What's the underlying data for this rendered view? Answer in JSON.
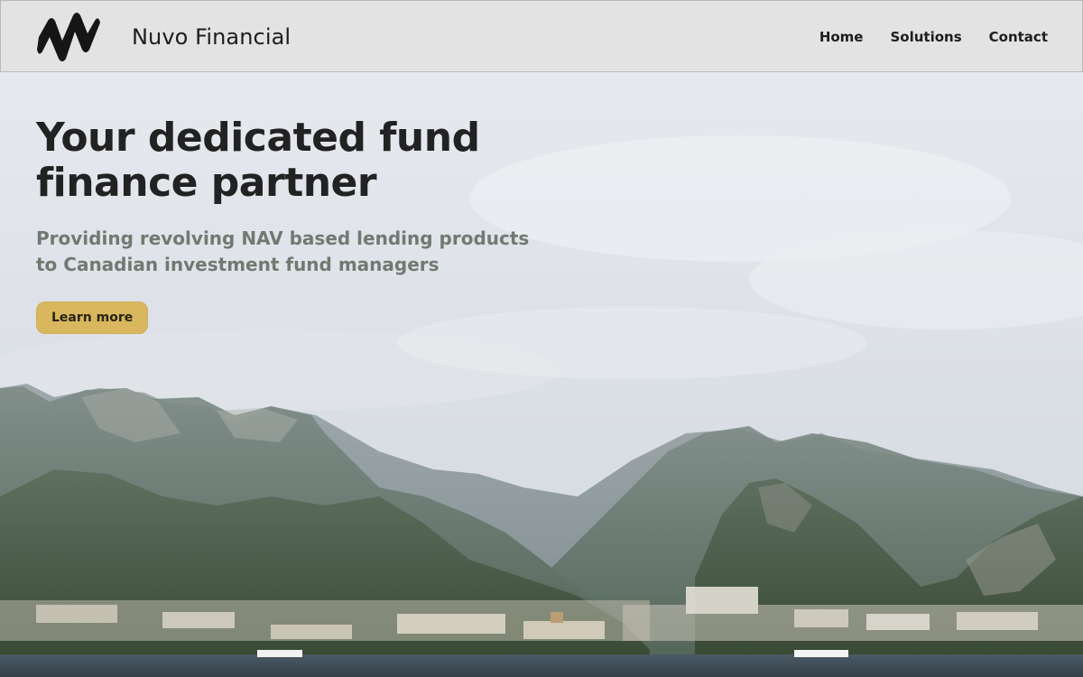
{
  "header": {
    "brand_name": "Nuvo Financial",
    "logo_icon": "nuvo-logo-mark",
    "nav": [
      {
        "label": "Home"
      },
      {
        "label": "Solutions"
      },
      {
        "label": "Contact"
      }
    ]
  },
  "hero": {
    "title": "Your dedicated fund finance partner",
    "subtitle": "Providing revolving NAV based lending products to Canadian investment fund managers",
    "cta_label": "Learn more",
    "background_image": "coastal-mountain-town-photo"
  },
  "colors": {
    "header_bg": "#e3e3e3",
    "title": "#222222",
    "subtitle": "#6f7a72",
    "cta_bg": "#d8b75e"
  }
}
